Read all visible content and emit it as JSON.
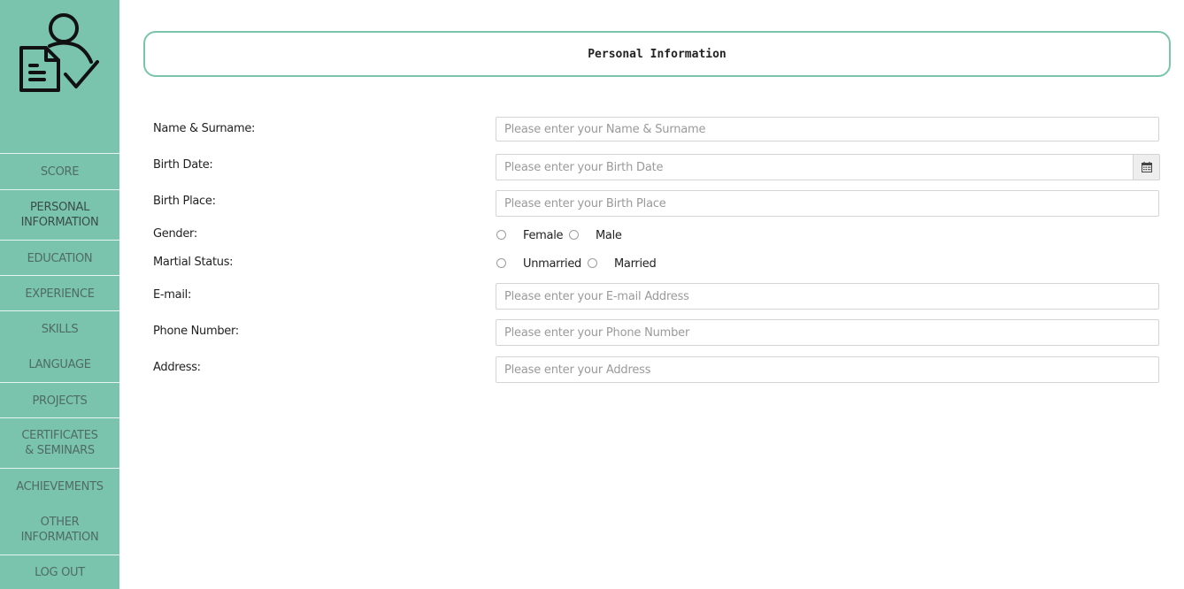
{
  "sidebar": {
    "logo_icon": "cv-checklist-user-icon",
    "items": [
      {
        "label": "SCORE"
      },
      {
        "label": "PERSONAL\nINFORMATION"
      },
      {
        "label": "EDUCATION"
      },
      {
        "label": "EXPERIENCE"
      },
      {
        "label": "SKILLS"
      },
      {
        "label": "LANGUAGE"
      },
      {
        "label": "PROJECTS"
      },
      {
        "label": "CERTIFICATES\n& SEMINARS"
      },
      {
        "label": "ACHIEVEMENTS"
      },
      {
        "label": "OTHER\nINFORMATION"
      },
      {
        "label": "LOG OUT"
      }
    ]
  },
  "header": {
    "title": "Personal Information"
  },
  "form": {
    "name": {
      "label": "Name & Surname:",
      "placeholder": "Please enter your Name & Surname",
      "value": ""
    },
    "birth_date": {
      "label": "Birth Date:",
      "placeholder": "Please enter your Birth Date",
      "value": "",
      "icon": "calendar-icon"
    },
    "birth_place": {
      "label": "Birth Place:",
      "placeholder": "Please enter your Birth Place",
      "value": ""
    },
    "gender": {
      "label": "Gender:",
      "options": [
        "Female",
        "Male"
      ],
      "selected": null
    },
    "marital": {
      "label": "Martial Status:",
      "options": [
        "Unmarried",
        "Married"
      ],
      "selected": null
    },
    "email": {
      "label": "E-mail:",
      "placeholder": "Please enter your E-mail Address",
      "value": ""
    },
    "phone": {
      "label": "Phone Number:",
      "placeholder": "Please enter your Phone Number",
      "value": ""
    },
    "address": {
      "label": "Address:",
      "placeholder": "Please enter your Address",
      "value": ""
    }
  },
  "colors": {
    "accent": "#7ac4ad",
    "nav_text": "#4f6b64",
    "text": "#222222"
  }
}
